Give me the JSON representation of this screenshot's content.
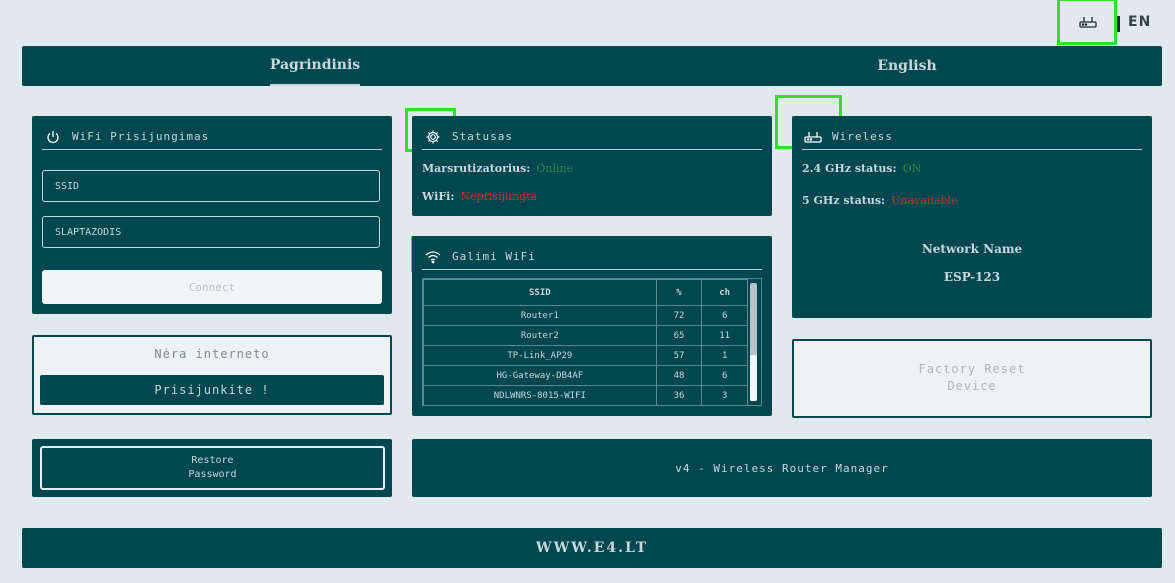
{
  "header": {
    "language_code": "EN"
  },
  "nav": {
    "tabs": [
      {
        "label": "Pagrindinis"
      },
      {
        "label": "English"
      }
    ]
  },
  "wifi_connect": {
    "title": "WiFi Prisijungimas",
    "ssid_value": "SSID",
    "password_value": "SLAPTAZODIS",
    "connect_label": "Connect"
  },
  "status": {
    "title": "Statusas",
    "line1_label": "Marsrutizatorius:",
    "line1_value": "Online",
    "line2_label": "WiFi:",
    "line2_value": "Neprisijungta",
    "colors": {
      "online": "#2e8b3d",
      "offline": "#c0392b"
    }
  },
  "internet": {
    "status_text": "Nėra interneto",
    "connect_label": "Prisijunkite !"
  },
  "reset_password": {
    "line1": "Restore",
    "line2": "Password"
  },
  "networks": {
    "title": "Galimi WiFi",
    "columns": [
      "SSID",
      "%",
      "ch"
    ],
    "rows": [
      [
        "Router1",
        "72",
        "6"
      ],
      [
        "Router2",
        "65",
        "11"
      ],
      [
        "TP-Link_AP29",
        "57",
        "1"
      ],
      [
        "HG-Gateway-DB4AF",
        "48",
        "6"
      ],
      [
        "NDLWNRS-8015-WIFI",
        "36",
        "3"
      ]
    ]
  },
  "wireless": {
    "title": "Wireless",
    "band24_label": "2.4 GHz status:",
    "band24_value": "ON",
    "band5_label": "5 GHz status:",
    "band5_value": "Unavailable",
    "network_name_label": "Network Name",
    "network_name_value": "ESP-123"
  },
  "factory_reset": {
    "line1": "Factory Reset",
    "line2": "Device"
  },
  "app_banner": {
    "text": "v4 - Wireless Router Manager"
  },
  "footer": {
    "text": "WWW.E4.LT"
  }
}
